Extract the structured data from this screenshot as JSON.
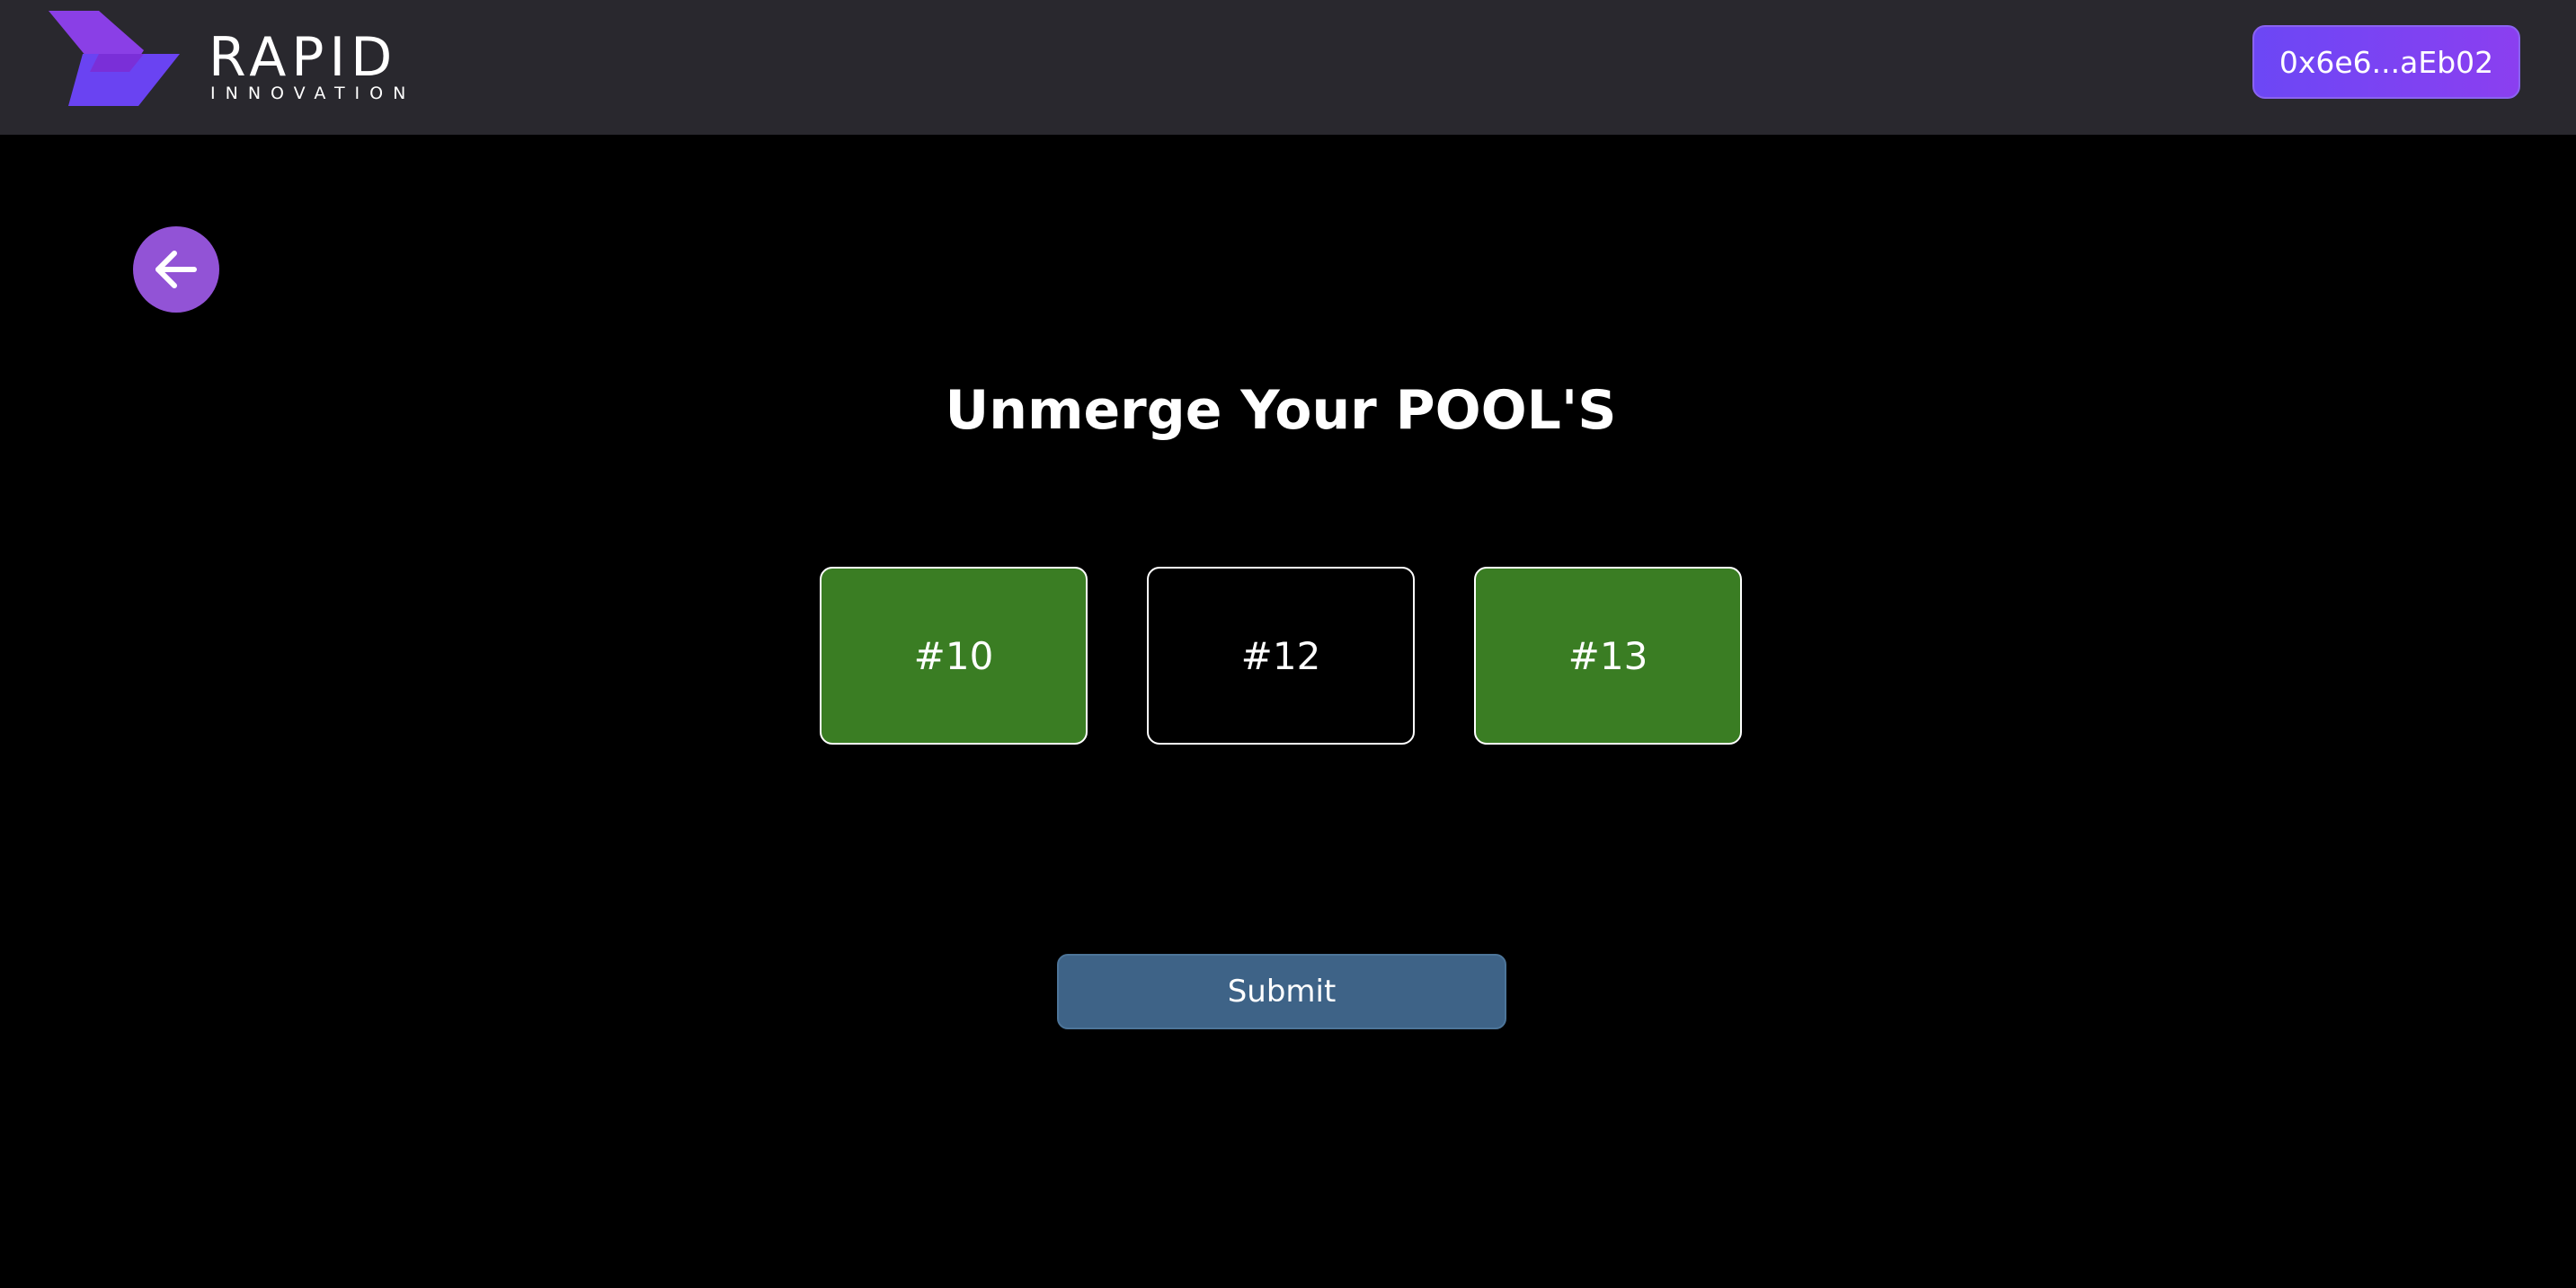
{
  "header": {
    "logo": {
      "word": "RAPID",
      "subword": "INNOVATION"
    },
    "wallet_address": "0x6e6...aEb02"
  },
  "main": {
    "back_icon": "arrow-left-icon",
    "title": "Unmerge Your POOL'S",
    "pools": [
      {
        "label": "#10",
        "selected": true
      },
      {
        "label": "#12",
        "selected": false
      },
      {
        "label": "#13",
        "selected": true
      }
    ],
    "submit_label": "Submit"
  },
  "colors": {
    "header_bg": "#29282e",
    "accent_purple": "#7b45f3",
    "back_button": "#9253d6",
    "selected_pool": "#3a7d23",
    "submit_button": "#3e6387"
  }
}
